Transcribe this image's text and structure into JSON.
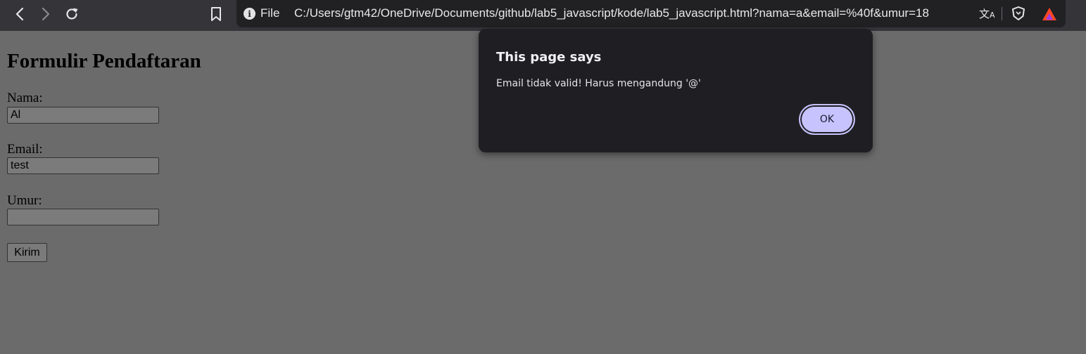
{
  "browser": {
    "scheme_label": "File",
    "url": "C:/Users/gtm42/OneDrive/Documents/github/lab5_javascript/kode/lab5_javascript.html?nama=a&email=%40f&umur=18"
  },
  "page": {
    "heading": "Formulir Pendaftaran",
    "fields": [
      {
        "label": "Nama:",
        "value": "Al"
      },
      {
        "label": "Email:",
        "value": "test"
      },
      {
        "label": "Umur:",
        "value": ""
      }
    ],
    "submit_label": "Kirim"
  },
  "dialog": {
    "title": "This page says",
    "message": "Email tidak valid! Harus mengandung '@'",
    "ok_label": "OK"
  },
  "colors": {
    "toolbar": "#353438",
    "omnibox": "#212023",
    "dimmed_page": "#6b6b6b",
    "dialog_bg": "#1f1e22",
    "ok_button": "#c6c3ff"
  }
}
